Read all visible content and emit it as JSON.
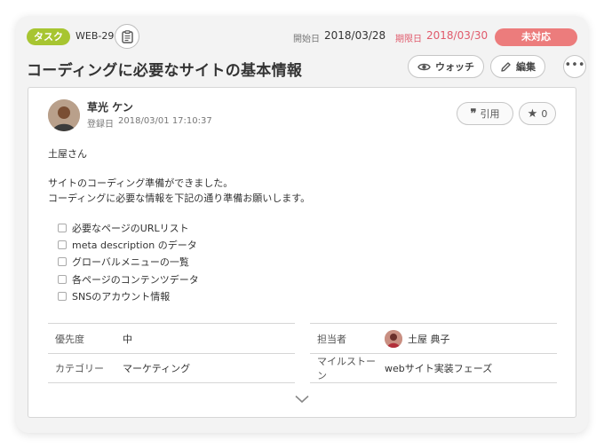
{
  "header": {
    "type_label": "タスク",
    "issue_key": "WEB-29",
    "start_label": "開始日",
    "start_date": "2018/03/28",
    "due_label": "期限日",
    "due_date": "2018/03/30",
    "status": "未対応"
  },
  "title": "コーディングに必要なサイトの基本情報",
  "actions": {
    "watch_label": "ウォッチ",
    "edit_label": "編集",
    "more_label": "•••"
  },
  "comment": {
    "author": "草光 ケン",
    "registered_label": "登録日",
    "registered_date": "2018/03/01 17:10:37",
    "quote_label": "引用",
    "star_count": "0",
    "greeting": "土屋さん",
    "line1": "サイトのコーディング準備ができました。",
    "line2": "コーディングに必要な情報を下記の通り準備お願いします。",
    "checklist": [
      "必要なページのURLリスト",
      "meta description のデータ",
      "グローバルメニューの一覧",
      "各ページのコンテンツデータ",
      "SNSのアカウント情報"
    ]
  },
  "properties": {
    "priority_label": "優先度",
    "priority_value": "中",
    "category_label": "カテゴリー",
    "category_value": "マーケティング",
    "assignee_label": "担当者",
    "assignee_value": "土屋 典子",
    "milestone_label": "マイルストーン",
    "milestone_value": "webサイト実装フェーズ"
  },
  "colors": {
    "type_badge": "#a7c531",
    "status_badge": "#ec7c7c",
    "due_text": "#e05a6b"
  }
}
